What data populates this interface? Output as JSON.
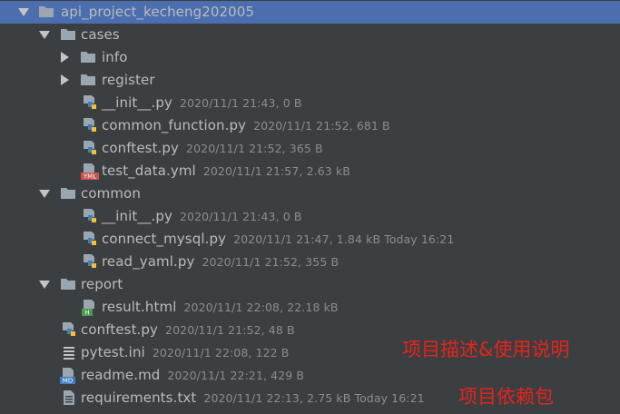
{
  "tree": {
    "root": {
      "name": "api_project_kecheng202005"
    },
    "cases": {
      "name": "cases",
      "info": {
        "name": "info"
      },
      "register": {
        "name": "register"
      },
      "init": {
        "name": "__init__.py",
        "meta": "2020/11/1 21:43, 0 B"
      },
      "common_function": {
        "name": "common_function.py",
        "meta": "2020/11/1 21:52, 681 B"
      },
      "conftest": {
        "name": "conftest.py",
        "meta": "2020/11/1 21:52, 365 B"
      },
      "test_data": {
        "name": "test_data.yml",
        "meta": "2020/11/1 21:57, 2.63 kB"
      }
    },
    "common": {
      "name": "common",
      "init": {
        "name": "__init__.py",
        "meta": "2020/11/1 21:43, 0 B"
      },
      "connect_mysql": {
        "name": "connect_mysql.py",
        "meta": "2020/11/1 21:47, 1.84 kB",
        "extra": "Today 16:21"
      },
      "read_yaml": {
        "name": "read_yaml.py",
        "meta": "2020/11/1 21:52, 355 B"
      }
    },
    "report": {
      "name": "report",
      "result": {
        "name": "result.html",
        "meta": "2020/11/1 22:08, 22.18 kB"
      }
    },
    "conftest": {
      "name": "conftest.py",
      "meta": "2020/11/1 21:52, 48 B"
    },
    "pytest_ini": {
      "name": "pytest.ini",
      "meta": "2020/11/1 22:08, 122 B"
    },
    "readme": {
      "name": "readme.md",
      "meta": "2020/11/1 22:21, 429 B"
    },
    "requirements": {
      "name": "requirements.txt",
      "meta": "2020/11/1 22:13, 2.75 kB",
      "extra": "Today 16:21"
    }
  },
  "annotations": {
    "readme_note": "项目描述&使用说明",
    "requirements_note": "项目依赖包"
  },
  "icons": {
    "folder": "folder-icon",
    "python": "python-file-icon",
    "yaml": "yaml-file-icon",
    "html": "html-file-icon",
    "ini": "ini-file-icon",
    "markdown": "markdown-file-icon",
    "text": "text-file-icon"
  },
  "colors": {
    "background": "#3c3f41",
    "selection": "#4b6eaf",
    "text": "#bbbbbb",
    "meta": "#8c8c8c",
    "annotation": "#e8221b"
  }
}
